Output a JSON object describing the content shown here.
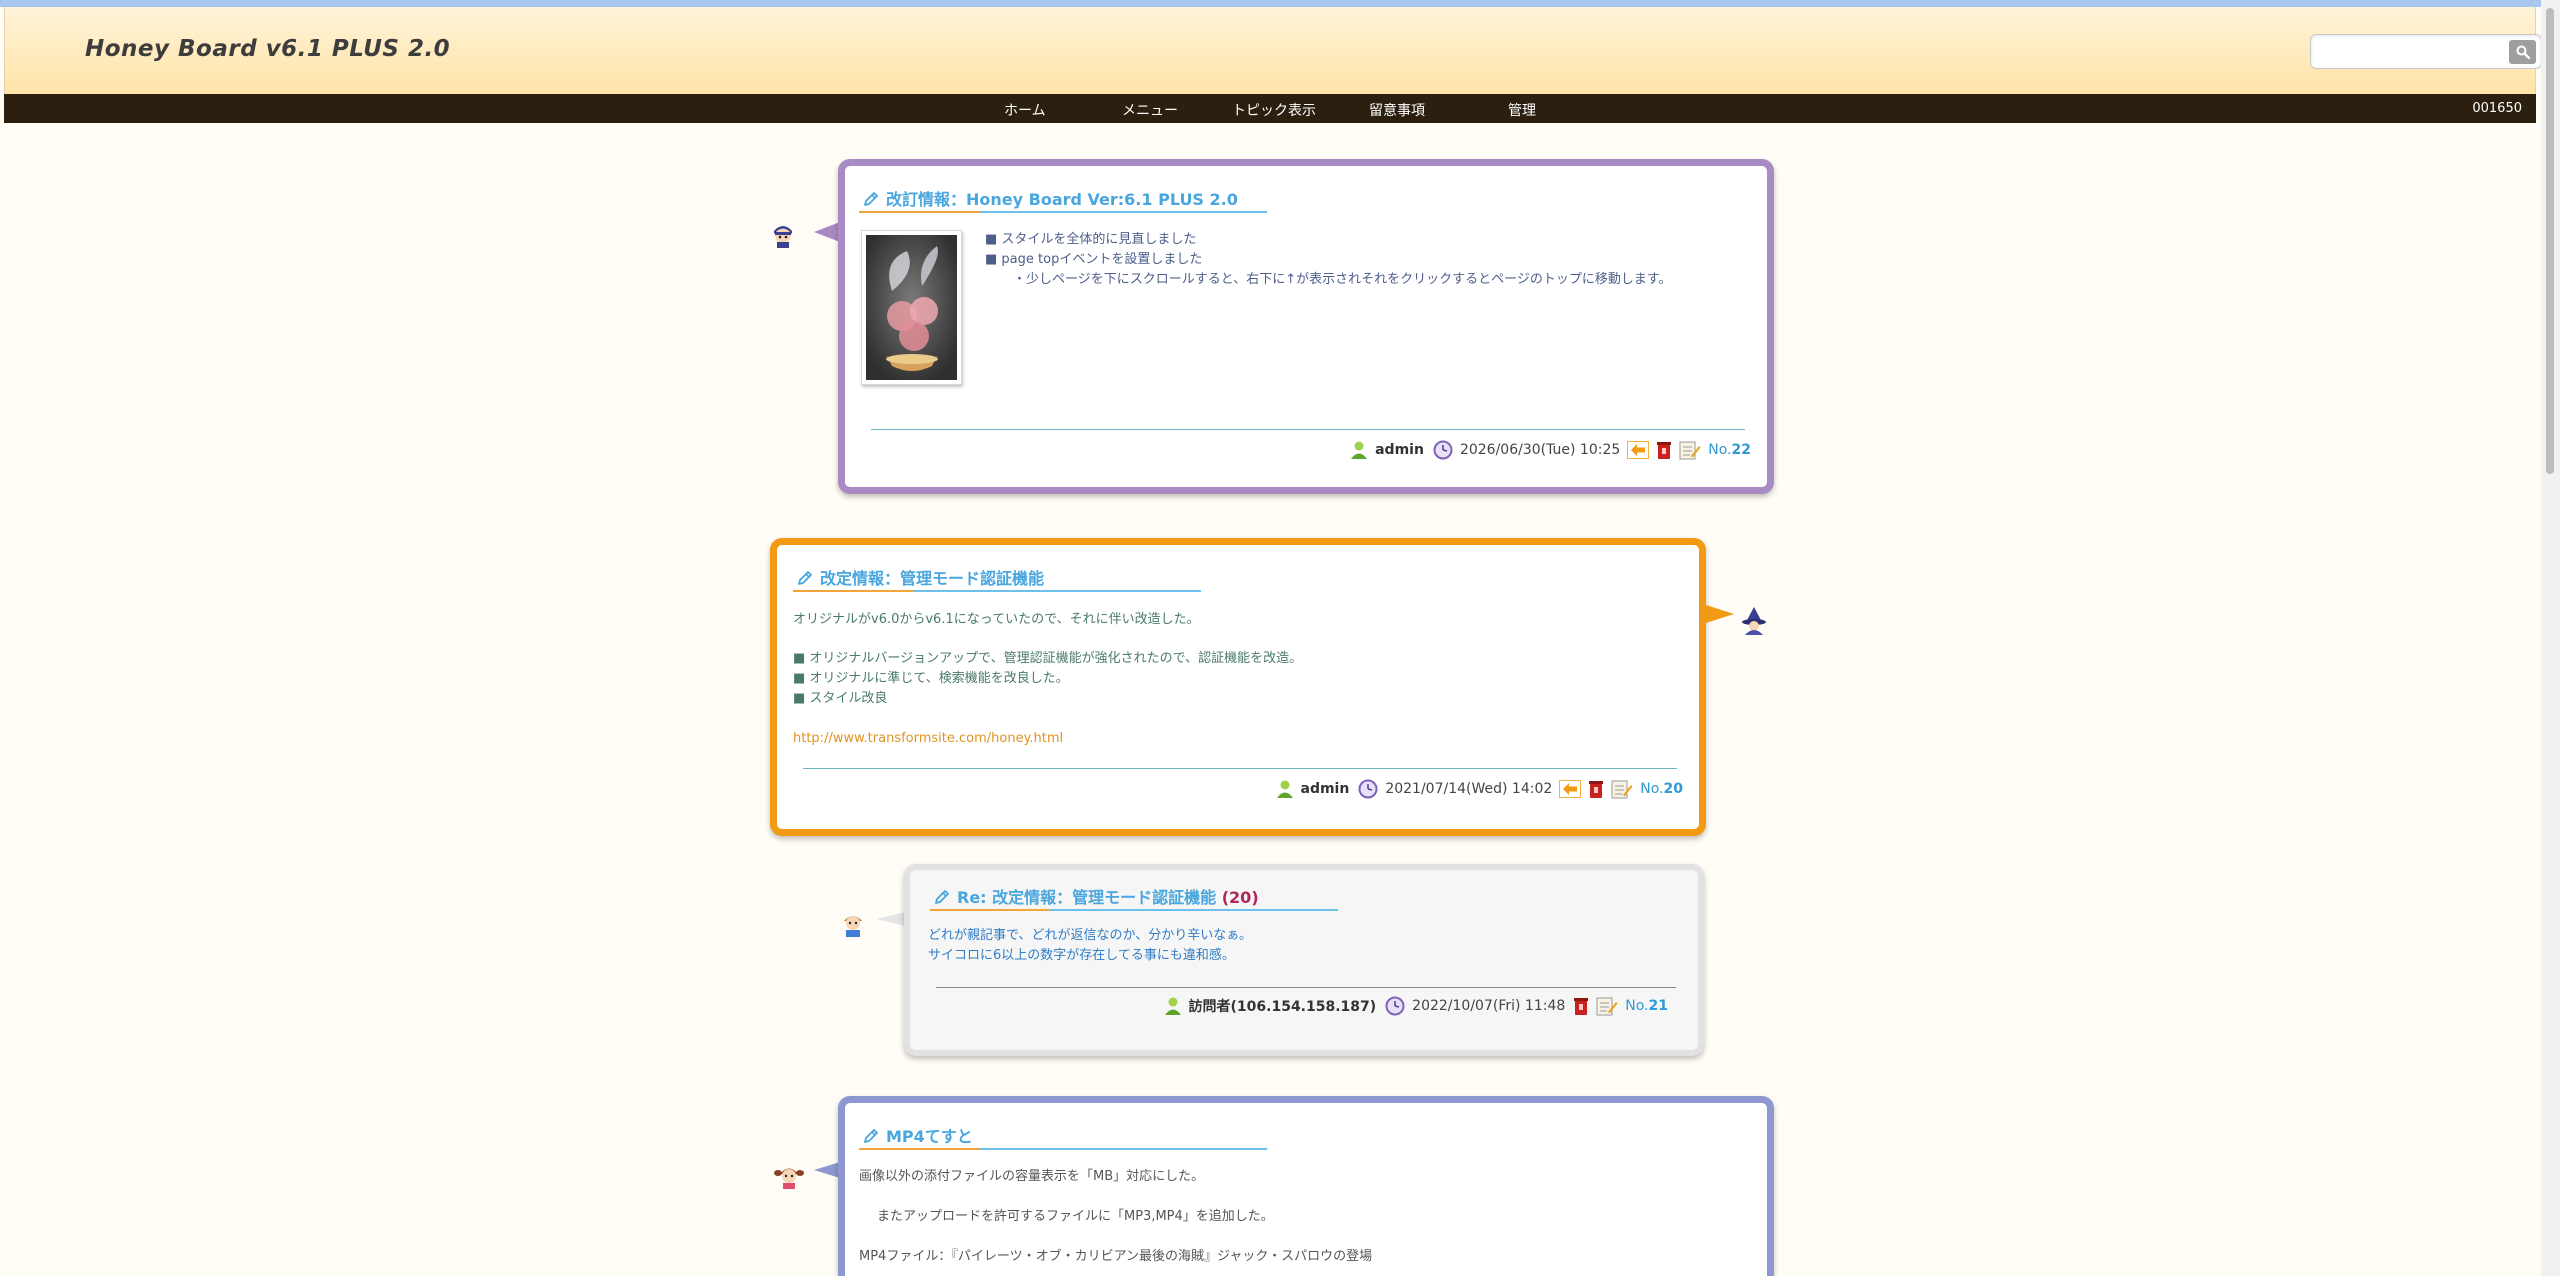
{
  "header": {
    "site_title": "Honey Board v6.1 PLUS 2.0",
    "search_placeholder": ""
  },
  "nav": {
    "items": [
      {
        "label": "ホーム"
      },
      {
        "label": "メニュー"
      },
      {
        "label": "トピック表示"
      },
      {
        "label": "留意事項"
      },
      {
        "label": "管理"
      }
    ],
    "counter": "001650"
  },
  "posts": [
    {
      "title": "改訂情報：Honey Board Ver:6.1 PLUS 2.0",
      "lines": [
        "■ スタイルを全体的に見直しました",
        "■ page topイベントを設置しました",
        "・少しページを下にスクロールすると、右下に↑が表示されそれをクリックするとページのトップに移動します。"
      ],
      "author": "admin",
      "date": "2026/06/30(Tue) 10:25",
      "no_prefix": "No.",
      "no": "22"
    },
    {
      "title": "改定情報：管理モード認証機能",
      "lines": [
        "オリジナルがv6.0からv6.1になっていたので、それに伴い改造した。",
        "■ オリジナルバージョンアップで、管理認証機能が強化されたので、認証機能を改造。",
        "■ オリジナルに準じて、検索機能を改良した。",
        "■ スタイル改良"
      ],
      "link": "http://www.transformsite.com/honey.html",
      "author": "admin",
      "date": "2021/07/14(Wed) 14:02",
      "no_prefix": "No.",
      "no": "20"
    },
    {
      "title": "Re: 改定情報：管理モード認証機能",
      "count": "(20)",
      "lines": [
        "どれが親記事で、どれが返信なのか、分かり辛いなぁ。",
        "サイコロに6以上の数字が存在してる事にも違和感。"
      ],
      "author": "訪問者(106.154.158.187)",
      "date": "2022/10/07(Fri) 11:48",
      "no_prefix": "No.",
      "no": "21"
    },
    {
      "title": "MP4てすと",
      "lines": [
        "画像以外の添付ファイルの容量表示を「MB」対応にした。",
        "またアップロードを許可するファイルに「MP3,MP4」を追加した。",
        "MP4ファイル：『パイレーツ・オブ・カリビアン最後の海賊』ジャック・スパロウの登場"
      ]
    }
  ],
  "colors": {
    "post1_border": "#a98bc4",
    "post2_border": "#f39a14",
    "post3_border": "#d9d9d9",
    "post4_border": "#8f97d0",
    "title_blue": "#49a6de",
    "nav_bg": "#2b2010"
  }
}
